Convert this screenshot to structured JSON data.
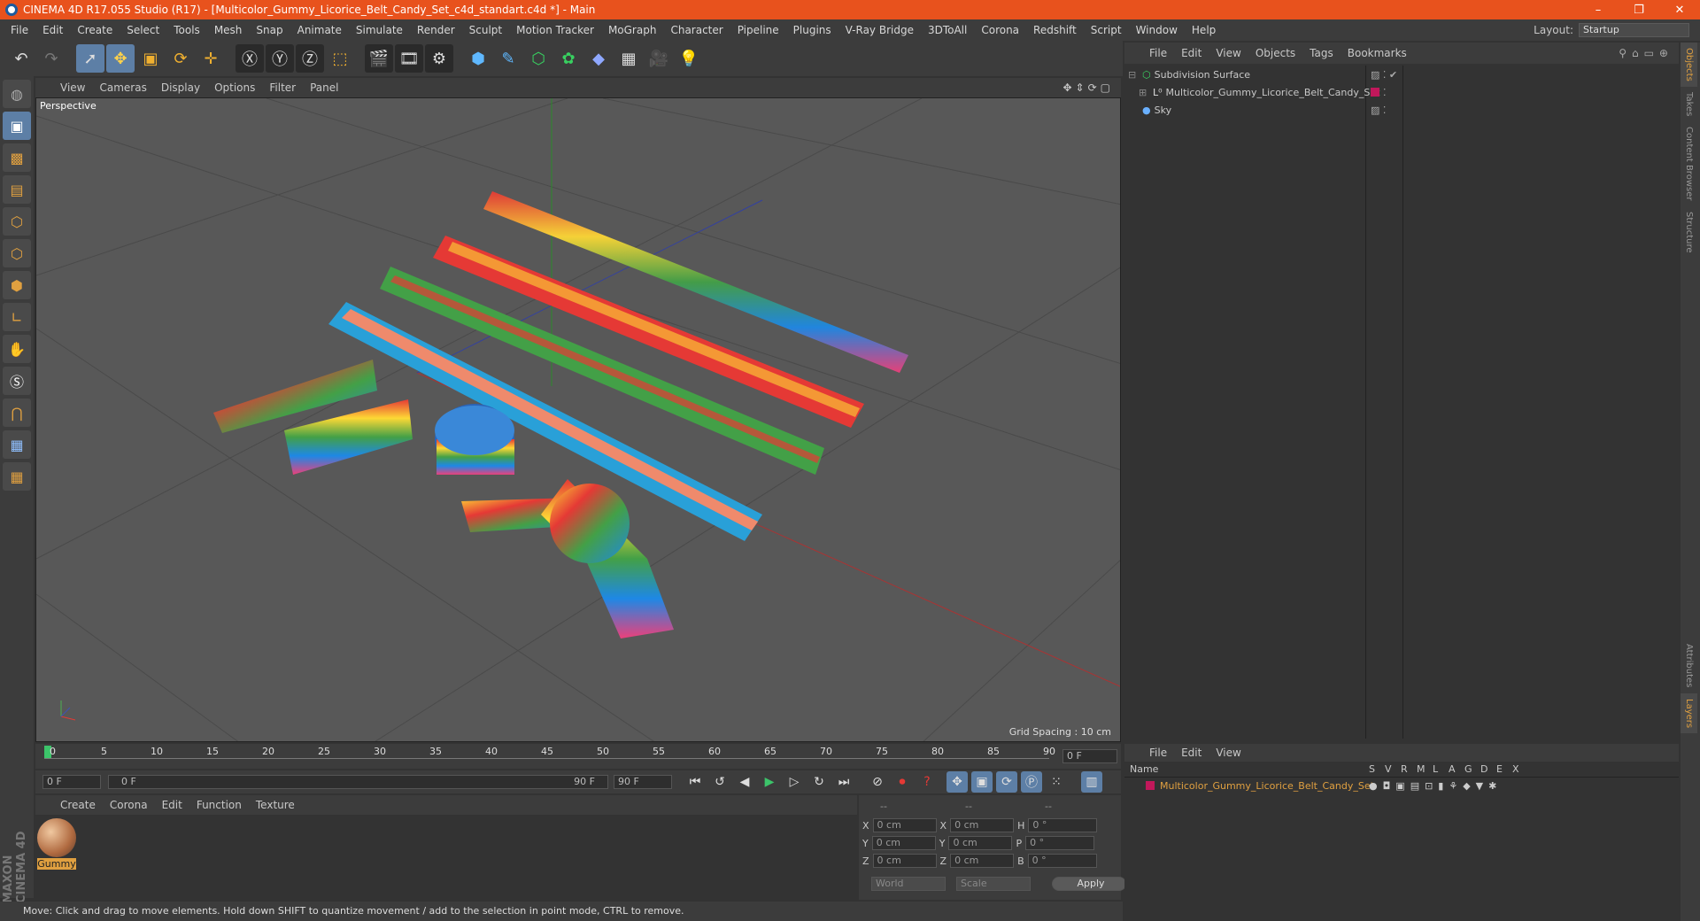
{
  "titlebar": {
    "title": "CINEMA 4D R17.055 Studio (R17) - [Multicolor_Gummy_Licorice_Belt_Candy_Set_c4d_standart.c4d *] - Main",
    "minimize": "–",
    "restore": "❐",
    "close": "✕"
  },
  "menubar": {
    "items": [
      "File",
      "Edit",
      "Create",
      "Select",
      "Tools",
      "Mesh",
      "Snap",
      "Animate",
      "Simulate",
      "Render",
      "Sculpt",
      "Motion Tracker",
      "MoGraph",
      "Character",
      "Pipeline",
      "Plugins",
      "V-Ray Bridge",
      "3DToAll",
      "Corona",
      "Redshift",
      "Script",
      "Window",
      "Help"
    ],
    "layout_label": "Layout:",
    "layout_value": "Startup"
  },
  "viewport": {
    "menu": [
      "View",
      "Cameras",
      "Display",
      "Options",
      "Filter",
      "Panel"
    ],
    "camera_label": "Perspective",
    "grid_spacing": "Grid Spacing : 10 cm"
  },
  "timeline": {
    "ticks": [
      "0",
      "5",
      "10",
      "15",
      "20",
      "25",
      "30",
      "35",
      "40",
      "45",
      "50",
      "55",
      "60",
      "65",
      "70",
      "75",
      "80",
      "85",
      "90"
    ],
    "current_frame": "0 F",
    "start_field": "0 F",
    "range_start": "0 F",
    "range_end": "90 F",
    "end_field": "90 F"
  },
  "material_manager": {
    "menu": [
      "Create",
      "Corona",
      "Edit",
      "Function",
      "Texture"
    ],
    "materials": [
      {
        "name": "Gummy"
      }
    ]
  },
  "coordinates": {
    "headers": [
      "--",
      "--",
      "--"
    ],
    "rows": [
      {
        "a": "X",
        "av": "0 cm",
        "b": "X",
        "bv": "0 cm",
        "c": "H",
        "cv": "0 °"
      },
      {
        "a": "Y",
        "av": "0 cm",
        "b": "Y",
        "bv": "0 cm",
        "c": "P",
        "cv": "0 °"
      },
      {
        "a": "Z",
        "av": "0 cm",
        "b": "Z",
        "bv": "0 cm",
        "c": "B",
        "cv": "0 °"
      }
    ],
    "mode": "World",
    "scale": "Scale",
    "apply": "Apply"
  },
  "statusbar": {
    "text": "Move: Click and drag to move elements. Hold down SHIFT to quantize movement / add to the selection in point mode, CTRL to remove."
  },
  "object_manager": {
    "menu": [
      "File",
      "Edit",
      "View",
      "Objects",
      "Tags",
      "Bookmarks"
    ],
    "objects": [
      {
        "name": "Subdivision Surface",
        "color": "#cfcfcf"
      },
      {
        "name": "Multicolor_Gummy_Licorice_Belt_Candy_Set",
        "color": "#cfcfcf"
      },
      {
        "name": "Sky",
        "color": "#cfcfcf"
      }
    ]
  },
  "layer_manager": {
    "menu": [
      "File",
      "Edit",
      "View"
    ],
    "columns": [
      "Name",
      "S",
      "V",
      "R",
      "M",
      "L",
      "A",
      "G",
      "D",
      "E",
      "X"
    ],
    "layers": [
      {
        "name": "Multicolor_Gummy_Licorice_Belt_Candy_Set",
        "color": "#c2185b"
      }
    ]
  },
  "side_tabs": [
    "Objects",
    "Takes",
    "Content Browser",
    "Structure",
    "Attributes",
    "Layers"
  ],
  "colors": {
    "titlebar": "#e8521d",
    "accent": "#e0a040",
    "selected_tool": "#5d7fa6"
  }
}
